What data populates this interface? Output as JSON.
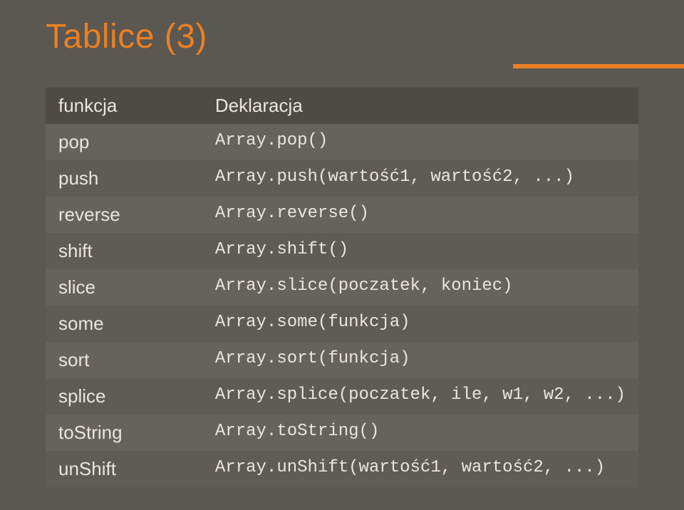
{
  "title": "Tablice (3)",
  "table": {
    "headers": [
      "funkcja",
      "Deklaracja"
    ],
    "rows": [
      {
        "fn": "pop",
        "decl": "Array.pop()"
      },
      {
        "fn": "push",
        "decl": "Array.push(wartość1, wartość2, ...)"
      },
      {
        "fn": "reverse",
        "decl": "Array.reverse()"
      },
      {
        "fn": "shift",
        "decl": "Array.shift()"
      },
      {
        "fn": "slice",
        "decl": "Array.slice(poczatek, koniec)"
      },
      {
        "fn": "some",
        "decl": "Array.some(funkcja)"
      },
      {
        "fn": "sort",
        "decl": "Array.sort(funkcja)"
      },
      {
        "fn": "splice",
        "decl": "Array.splice(poczatek, ile, w1, w2, ...)"
      },
      {
        "fn": "toString",
        "decl": "Array.toString()"
      },
      {
        "fn": "unShift",
        "decl": "Array.unShift(wartość1, wartość2, ...)"
      }
    ]
  }
}
